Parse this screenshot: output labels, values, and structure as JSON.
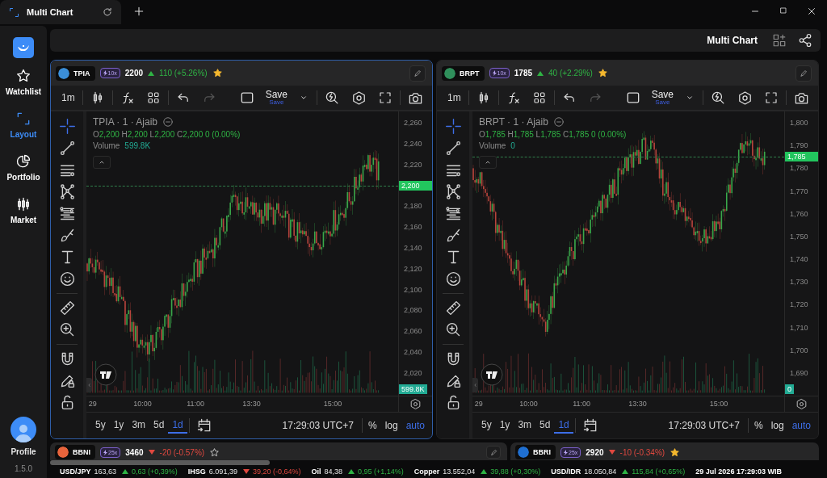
{
  "window": {
    "tab_title": "Multi Chart"
  },
  "sidebar": {
    "items": [
      {
        "label": "Watchlist",
        "kind": "watchlist",
        "selected": false
      },
      {
        "label": "Layout",
        "kind": "layout",
        "selected": true
      },
      {
        "label": "Portfolio",
        "kind": "portfolio",
        "selected": false
      },
      {
        "label": "Market",
        "kind": "market",
        "selected": false
      }
    ],
    "profile": {
      "label": "Profile"
    },
    "version": "1.5.0"
  },
  "header": {
    "title": "Multi Chart"
  },
  "charts": [
    {
      "symbol": "TPIA",
      "color": "#3b8fd9",
      "leverage": "10x",
      "price": "2200",
      "rising": true,
      "change": "110 (+5.26%)",
      "favorite": true,
      "selected": true,
      "interval": "1m",
      "save": "Save",
      "save_caption": "Save",
      "redo_disabled": true,
      "crosshair_active": true,
      "legend": {
        "title": "TPIA · 1 · Ajaib",
        "ohlc": [
          {
            "label": "O",
            "value": "2,200"
          },
          {
            "label": "H",
            "value": "2,200"
          },
          {
            "label": "L",
            "value": "2,200"
          },
          {
            "label": "C",
            "value": "2,200"
          }
        ],
        "change": "0 (0.00%)",
        "volume_label": "Volume",
        "volume": "599.8K"
      },
      "yticks": [
        "2,260",
        "2,240",
        "2,220",
        "2,180",
        "2,160",
        "2,140",
        "2,120",
        "2,100",
        "2,080",
        "2,060",
        "2,040",
        "2,020"
      ],
      "last_price": "2,200",
      "volume_tag": "599.8K",
      "xticks": [
        "29",
        "10:00",
        "11:00",
        "13:30",
        "15:00"
      ],
      "ranges": [
        {
          "label": "5y",
          "selected": false
        },
        {
          "label": "1y",
          "selected": false
        },
        {
          "label": "3m",
          "selected": false
        },
        {
          "label": "5d",
          "selected": false
        },
        {
          "label": "1d",
          "selected": true
        }
      ],
      "time": "17:29:03 UTC+7",
      "scales": [
        {
          "label": "%",
          "selected": false
        },
        {
          "label": "log",
          "selected": false
        },
        {
          "label": "auto",
          "selected": true
        }
      ]
    },
    {
      "symbol": "BRPT",
      "color": "#2f8f5b",
      "leverage": "10x",
      "price": "1785",
      "rising": true,
      "change": "40 (+2.29%)",
      "favorite": true,
      "selected": false,
      "interval": "1m",
      "save": "Save",
      "save_caption": "Save",
      "redo_disabled": true,
      "crosshair_active": true,
      "legend": {
        "title": "BRPT · 1 · Ajaib",
        "ohlc": [
          {
            "label": "O",
            "value": "1,785"
          },
          {
            "label": "H",
            "value": "1,785"
          },
          {
            "label": "L",
            "value": "1,785"
          },
          {
            "label": "C",
            "value": "1,785"
          }
        ],
        "change": "0 (0.00%)",
        "volume_label": "Volume",
        "volume": "0"
      },
      "yticks": [
        "1,800",
        "1,790",
        "1,780",
        "1,770",
        "1,760",
        "1,750",
        "1,740",
        "1,730",
        "1,720",
        "1,710",
        "1,700",
        "1,690"
      ],
      "last_price": "1,785",
      "volume_tag": "0",
      "xticks": [
        "29",
        "10:00",
        "11:00",
        "13:30",
        "15:00"
      ],
      "ranges": [
        {
          "label": "5y",
          "selected": false
        },
        {
          "label": "1y",
          "selected": false
        },
        {
          "label": "3m",
          "selected": false
        },
        {
          "label": "5d",
          "selected": false
        },
        {
          "label": "1d",
          "selected": true
        }
      ],
      "time": "17:29:03 UTC+7",
      "scales": [
        {
          "label": "%",
          "selected": false
        },
        {
          "label": "log",
          "selected": false
        },
        {
          "label": "auto",
          "selected": true
        }
      ]
    }
  ],
  "mini_charts": [
    {
      "symbol": "BBNI",
      "color": "#e8643c",
      "leverage": "25x",
      "price": "3460",
      "rising": false,
      "change": "-20 (-0.57%)",
      "favorite": false,
      "edit_button": true
    },
    {
      "symbol": "BBRI",
      "color": "#1f6fd1",
      "leverage": "25x",
      "price": "2920",
      "rising": false,
      "change": "-10 (-0.34%)",
      "favorite": true,
      "edit_button": false
    }
  ],
  "ticker": {
    "items": [
      {
        "name": "USD/JPY",
        "value": "163,63",
        "rising": true,
        "change": "0,63 (+0,39%)"
      },
      {
        "name": "IHSG",
        "value": "6.091,39",
        "rising": false,
        "change": "39,20 (-0,64%)"
      },
      {
        "name": "Oil",
        "value": "84,38",
        "rising": true,
        "change": "0,95 (+1,14%)"
      },
      {
        "name": "Copper",
        "value": "13.552,04",
        "rising": true,
        "change": "39,88 (+0,30%)"
      },
      {
        "name": "USD/IDR",
        "value": "18.050,84",
        "rising": true,
        "change": "115,84 (+0,65%)"
      }
    ],
    "datetime": "29 Jul 2026 17:29:03 WIB"
  }
}
